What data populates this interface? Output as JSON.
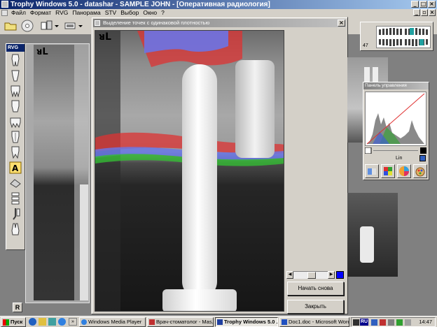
{
  "window": {
    "title": "Trophy Windows 5.0 - datashar - SAMPLE JOHN - [Оперативная радиология]"
  },
  "menu": [
    "Файл",
    "Формат",
    "RVG",
    "Панорама",
    "STV",
    "Выбор",
    "Окно",
    "?"
  ],
  "toolbar": {
    "buttons": [
      "folder-open-icon",
      "cd-disk-icon",
      "layout-icon",
      "sensor-icon"
    ]
  },
  "rvg_panel": {
    "title": "RVG",
    "tools": [
      "tooth-1-icon",
      "tooth-2-icon",
      "tooth-3-icon",
      "tooth-4-icon",
      "tooth-5-icon",
      "tooth-6-icon",
      "tooth-7-icon",
      "text-tool-icon",
      "eraser-icon",
      "stack-icon",
      "probe-icon",
      "tooth-lower-icon"
    ]
  },
  "markers": {
    "left": "ᴚL",
    "main": "ᴚL",
    "badge": "R"
  },
  "dialog": {
    "title": "Выделение точек с одинаковой плотностью",
    "restart_label": "Начать снова",
    "close_label": "Закрыть",
    "slider": {
      "value": 0.55,
      "highlight_color": "#0000ff"
    }
  },
  "odontogram": {
    "count": "47"
  },
  "control_panel": {
    "title": "Панель управления",
    "mode_label": "Lin",
    "buttons": [
      "contrast-icon",
      "palette-icon",
      "color-wheel-icon",
      "paint-icon"
    ]
  },
  "taskbar": {
    "start_label": "Пуск",
    "quick_launch": [
      "ie-icon",
      "outlook-icon",
      "desktop-icon",
      "media-icon"
    ],
    "tasks": [
      {
        "label": "Windows Media Player",
        "active": false
      },
      {
        "label": "Врач-стоматолог - Mas...",
        "active": false
      },
      {
        "label": "Trophy Windows 5.0 ...",
        "active": true
      },
      {
        "label": "Doc1.doc - Microsoft Word",
        "active": false
      }
    ],
    "tray": {
      "lang": "RU",
      "clock": "14:47"
    }
  },
  "colors": {
    "titlebar": "#0a246a",
    "highlight_red": "#dd3333",
    "highlight_blue": "#6677ee",
    "highlight_green": "#33bb33"
  }
}
